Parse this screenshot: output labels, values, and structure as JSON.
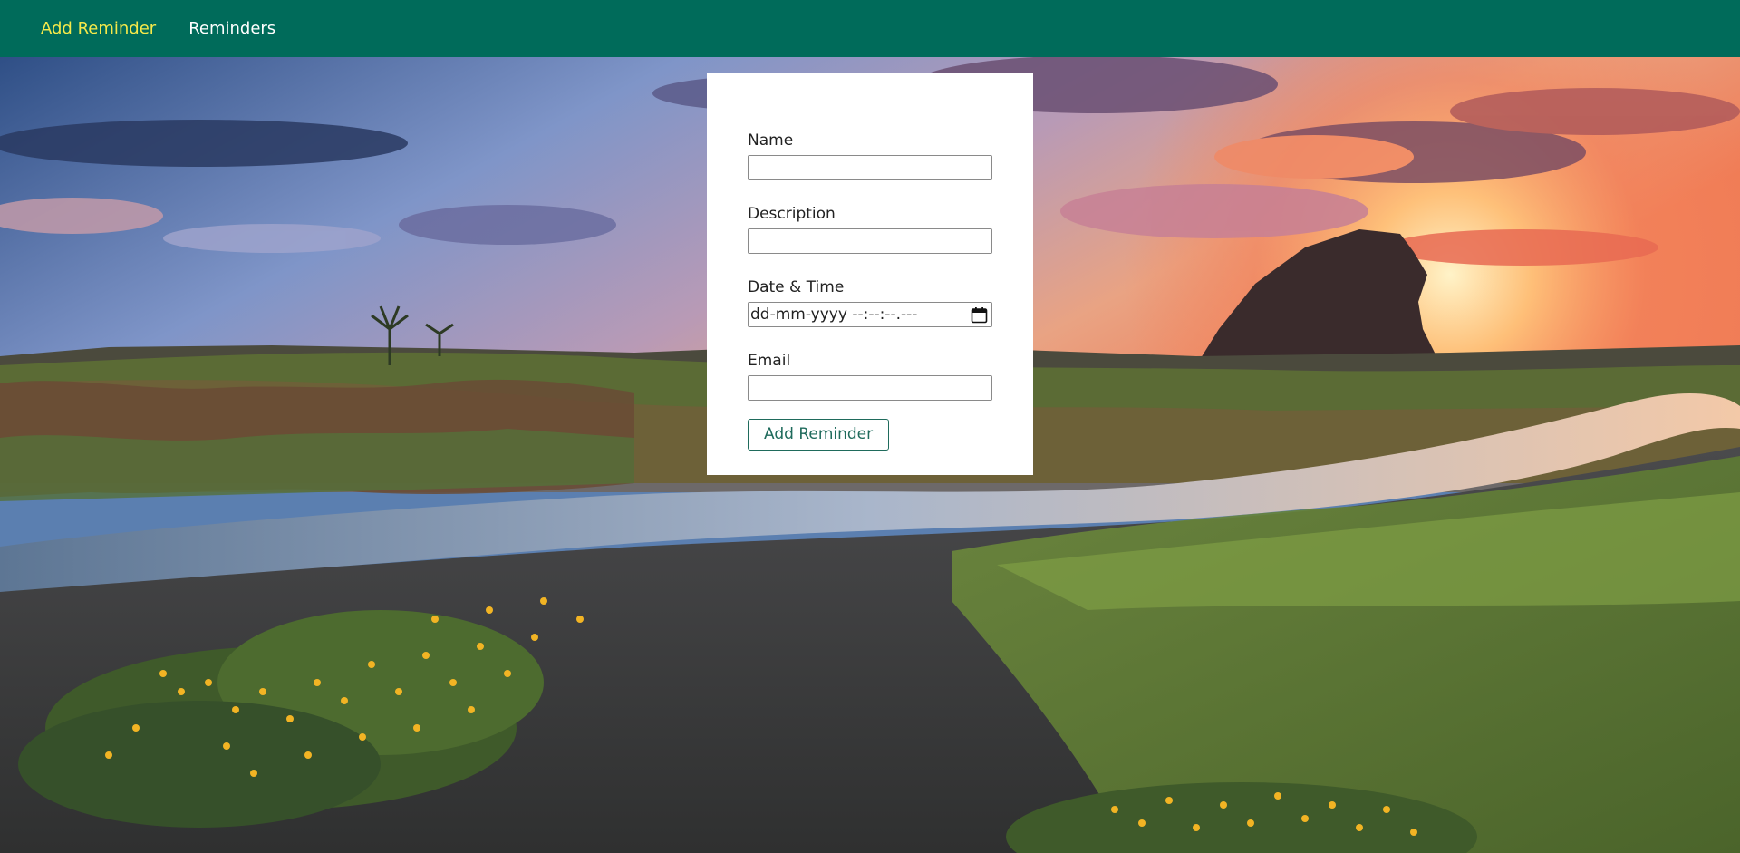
{
  "nav": {
    "items": [
      {
        "label": "Add Reminder",
        "active": true
      },
      {
        "label": "Reminders",
        "active": false
      }
    ],
    "background_color": "#006b5a",
    "active_color": "#f5e94a"
  },
  "form": {
    "name_label": "Name",
    "name_value": "",
    "description_label": "Description",
    "description_value": "",
    "datetime_label": "Date & Time",
    "datetime_placeholder": "dd-mm-yyyy --:--:--.---",
    "email_label": "Email",
    "email_value": "",
    "submit_label": "Add Reminder",
    "icons": {
      "datetime_picker": "calendar-icon"
    }
  },
  "background": {
    "description_icon": "landscape-photo",
    "accent_button_color": "#1f6b5c"
  }
}
